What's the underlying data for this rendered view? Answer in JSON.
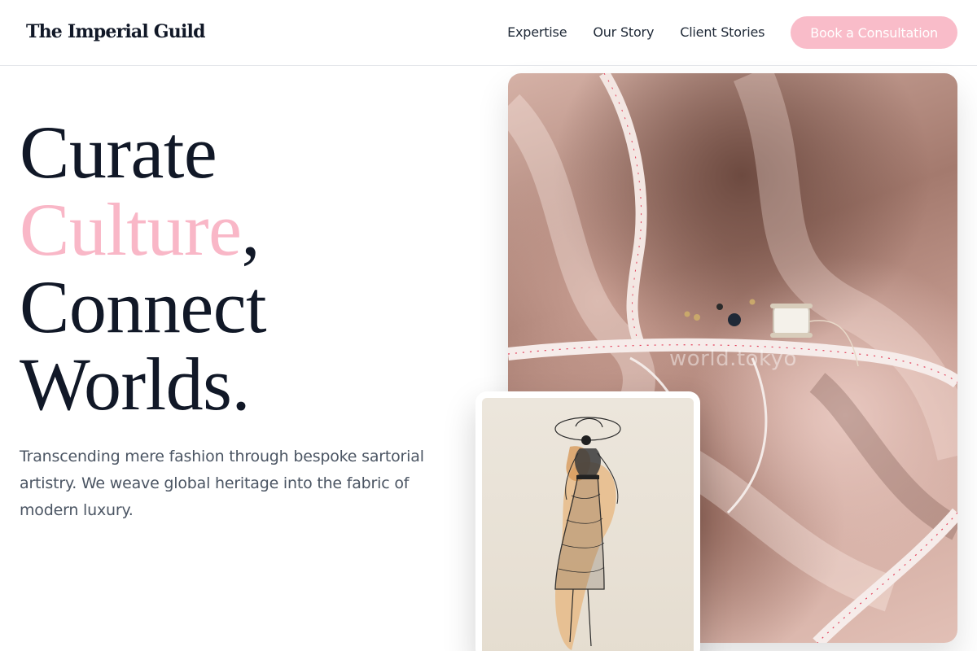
{
  "header": {
    "logo": "The Imperial Guild",
    "nav": [
      {
        "label": "Expertise"
      },
      {
        "label": "Our Story"
      },
      {
        "label": "Client Stories"
      }
    ],
    "cta_label": "Book a Consultation"
  },
  "hero": {
    "line1": "Curate",
    "line2_accent": "Culture",
    "line2_punct": ",",
    "line3": "Connect",
    "line4": "Worlds.",
    "body": "Transcending mere fashion through bespoke sartorial artistry. We weave global heritage into the fabric of modern luxury."
  },
  "images": {
    "main_watermark": "world.tokyo"
  },
  "colors": {
    "accent": "#f9b7c7",
    "cta_background": "#f9bcc9",
    "heading": "#111827",
    "body_text": "#4b5563"
  }
}
